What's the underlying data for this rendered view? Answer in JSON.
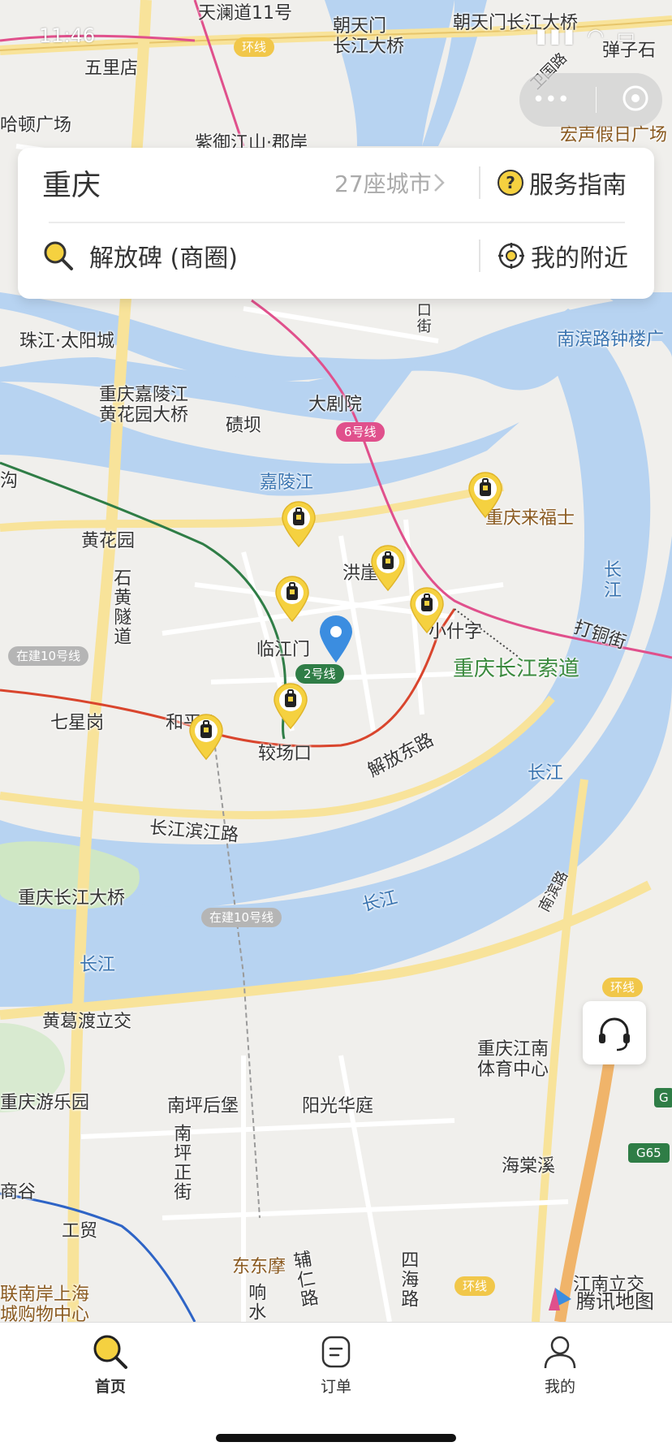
{
  "status_bar": {
    "time": "11:46"
  },
  "header_card": {
    "city": "重庆",
    "city_count": "27座城市",
    "service_guide": "服务指南",
    "search_value": "解放碑 (商圈)",
    "nearby": "我的附近"
  },
  "map_labels": {
    "tianlan": "天澜道11号",
    "chaotianmen_bridge": "朝天门\n长江大桥",
    "chaotianmen_yangtze": "朝天门长江大桥",
    "danzishi": "弹子石",
    "wulidian": "五里店",
    "harbin": "哈顿广场",
    "weiwei": "卫国路",
    "hongsheng": "宏声假日广场",
    "ziyu": "紫御江山·郡岸",
    "zhujiang": "珠江·太阳城",
    "kouchong": "口街",
    "nanbin_bell": "南滨路钟楼广",
    "huayuan_bridge": "重庆嘉陵江\n黄花园大桥",
    "daju": "大剧院",
    "qiqi": "碛坝",
    "jialing": "嘉陵江",
    "gou": "沟",
    "laifushi": "重庆来福士",
    "huanghuayuan": "黄花园",
    "hongya": "洪崖",
    "yangtze_v": "长\n江",
    "shihuang": "石黄隧道",
    "linjiangmen": "临江门",
    "xiaoshizi": "小什字",
    "datong": "打铜街",
    "cableway": "重庆长江索道",
    "qixinggang": "七星岗",
    "he": "和平",
    "jiaochangkou": "较场口",
    "jiefang_east": "解放东路",
    "yangtze1": "长江",
    "binjiang": "长江滨江路",
    "yangtze_bridge": "重庆长江大桥",
    "yangtze2": "长江",
    "nanbin_road": "南滨路",
    "yangtze3": "长江",
    "huangge": "黄葛渡立交",
    "nanan_sports": "重庆江南\n体育中心",
    "amusement": "重庆游乐园",
    "nanping": "南坪后堡",
    "yangguang": "阳光华庭",
    "haitang": "海棠溪",
    "shanggu": "商谷",
    "gongmao": "工贸",
    "nanping_st": "南坪正街",
    "dongdongmo": "东东摩",
    "fuxian": "辅仁路",
    "sihai": "四海路",
    "xiangshui": "响水",
    "jiangnan_interchange": "江南立交",
    "lianan": "联南岸上海\n城购物中心"
  },
  "map_pills": {
    "ring1": "环线",
    "ring2": "环线",
    "ring3": "环线",
    "line6": "6号线",
    "line2": "2号线",
    "line10a": "在建10号线",
    "line10b": "在建10号线",
    "g65": "G65",
    "g": "G"
  },
  "branding": {
    "map_provider": "腾讯地图"
  },
  "tabs": [
    {
      "label": "首页",
      "icon": "search-icon",
      "active": true
    },
    {
      "label": "订单",
      "icon": "order-icon",
      "active": false
    },
    {
      "label": "我的",
      "icon": "profile-icon",
      "active": false
    }
  ],
  "colors": {
    "river": "#b7d3f1",
    "land": "#f0efec",
    "road_yellow": "#f8e39a",
    "line6_pink": "#e0508c",
    "line2_green": "#2f7d46",
    "line1_red": "#d9452d",
    "line3_blue": "#2e64c6",
    "pin_yellow": "#f5d140",
    "location_blue": "#3b8de0"
  }
}
